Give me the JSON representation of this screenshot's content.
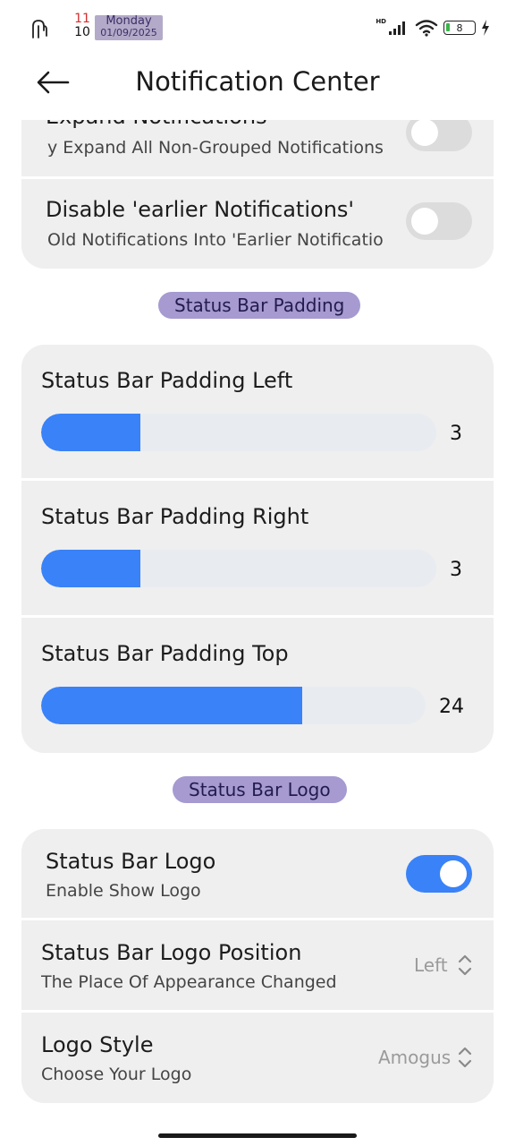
{
  "status_bar": {
    "hour": "11",
    "minute": "10",
    "day": "Monday",
    "date": "01/09/2025",
    "network": "HD",
    "battery": "8"
  },
  "app_bar": {
    "title": "Notification Center"
  },
  "notifications_card": {
    "rows": [
      {
        "title": "Expand Notifications",
        "subtitle": "y Expand All Non-Grouped Notifications",
        "enabled": false
      },
      {
        "title": "Disable 'earlier Notifications'",
        "subtitle": "Old Notifications Into 'Earlier Notificatio",
        "enabled": false
      }
    ]
  },
  "padding_section": {
    "label": "Status Bar Padding",
    "sliders": [
      {
        "title": "Status Bar Padding Left",
        "value": "3",
        "fill_fraction": 0.25
      },
      {
        "title": "Status Bar Padding Right",
        "value": "3",
        "fill_fraction": 0.25
      },
      {
        "title": "Status Bar Padding Top",
        "value": "24",
        "fill_fraction": 0.68
      }
    ]
  },
  "logo_section": {
    "label": "Status Bar Logo",
    "toggle_row": {
      "title": "Status Bar Logo",
      "subtitle": "Enable Show Logo",
      "enabled": true
    },
    "position_row": {
      "title": "Status Bar Logo Position",
      "subtitle": "The Place Of Appearance Changed",
      "value": "Left"
    },
    "style_row": {
      "title": "Logo Style",
      "subtitle": "Choose Your Logo",
      "value": "Amogus"
    }
  },
  "colors": {
    "accent": "#3a82f7",
    "section_label_bg": "#a69ad1",
    "card_bg": "#efefef"
  }
}
